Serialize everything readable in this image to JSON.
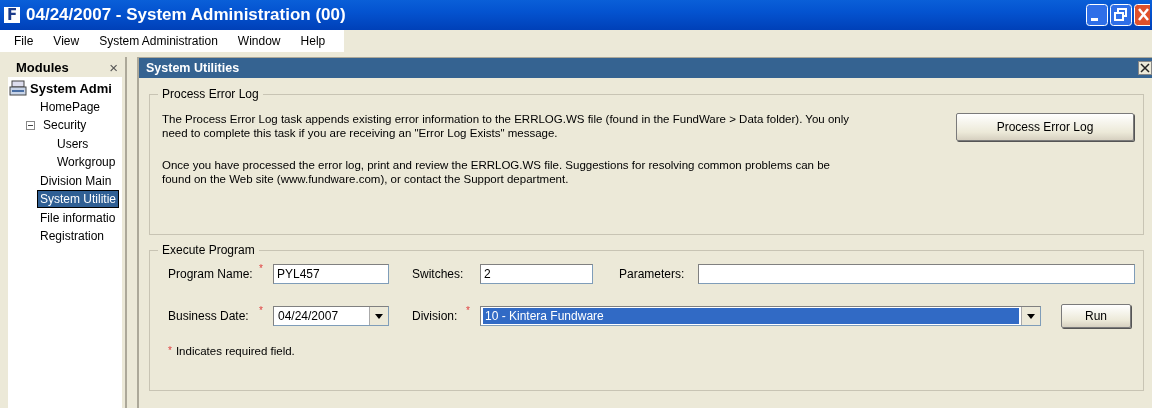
{
  "window": {
    "app_icon_letter": "F",
    "title": "04/24/2007 - System Administration (00)"
  },
  "menu": [
    {
      "label": "File"
    },
    {
      "label": "View"
    },
    {
      "label": "System Administration"
    },
    {
      "label": "Window"
    },
    {
      "label": "Help"
    }
  ],
  "sidebar": {
    "title": "Modules",
    "close": "×",
    "items": [
      {
        "label": "System Admi",
        "selected": false,
        "children": [
          {
            "label": "HomePage",
            "selected": false
          },
          {
            "label": "Security",
            "selected": false,
            "expanded": true,
            "children": [
              {
                "label": "Users",
                "selected": false
              },
              {
                "label": "Workgroup",
                "selected": false
              }
            ]
          },
          {
            "label": "Division Main",
            "selected": false
          },
          {
            "label": "System Utilitie",
            "selected": true
          },
          {
            "label": "File informatio",
            "selected": false
          },
          {
            "label": "Registration",
            "selected": false
          }
        ]
      }
    ]
  },
  "pane": {
    "title": "System Utilities",
    "process_error_log": {
      "legend": "Process Error Log",
      "paragraphs": [
        "The Process Error Log task appends existing error information to the ERRLOG.WS file (found in the FundWare > Data folder). You only need to complete this task if you are receiving an \"Error Log Exists\" message.",
        "Once you have processed the error log, print and review the ERRLOG.WS file. Suggestions for resolving common problems can be found on the Web site (www.fundware.com), or contact the Support department."
      ],
      "button": "Process Error Log"
    },
    "execute_program": {
      "legend": "Execute Program",
      "fields": [
        {
          "kind": "text",
          "label": "Program Name:",
          "required_mark": "*",
          "value": "PYL457"
        },
        {
          "kind": "text",
          "label": "Switches:",
          "value": "2"
        },
        {
          "kind": "text",
          "label": "Parameters:"
        },
        {
          "kind": "dropdown",
          "label": "Business Date:",
          "required_mark": "*",
          "value": "04/24/2007",
          "highlighted": false
        },
        {
          "kind": "dropdown",
          "label": "Division:",
          "required_mark": "*",
          "value": "10 - Kintera Fundware",
          "highlighted": true
        }
      ],
      "button": "Run",
      "note": {
        "mark": "*",
        "text": "Indicates required field."
      }
    }
  }
}
